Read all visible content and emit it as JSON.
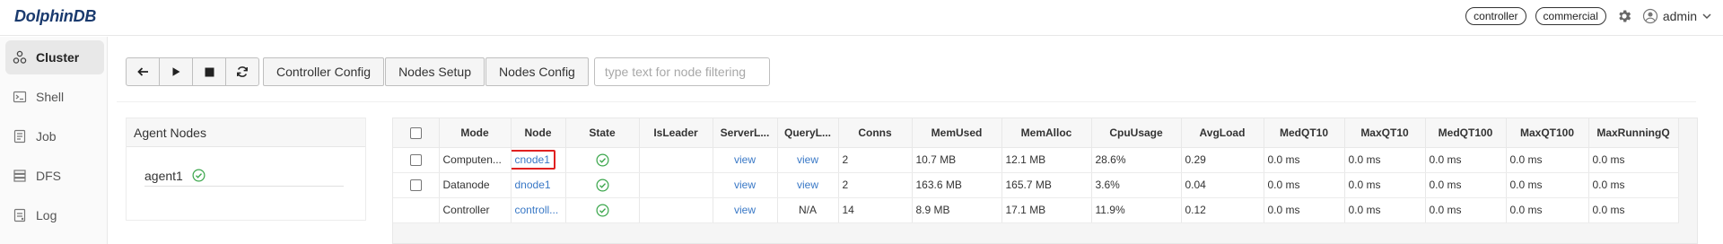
{
  "app": {
    "logo": "DolphinDB"
  },
  "header": {
    "role_badge": "controller",
    "edition_badge": "commercial",
    "settings_icon": "gear-icon",
    "user_icon": "user-circle-icon",
    "username": "admin"
  },
  "sidebar": {
    "items": [
      {
        "label": "Cluster",
        "icon": "cluster-icon",
        "active": true
      },
      {
        "label": "Shell",
        "icon": "shell-icon",
        "active": false
      },
      {
        "label": "Job",
        "icon": "job-icon",
        "active": false
      },
      {
        "label": "DFS",
        "icon": "dfs-icon",
        "active": false
      },
      {
        "label": "Log",
        "icon": "log-icon",
        "active": false
      }
    ]
  },
  "toolbar": {
    "controller_config": "Controller Config",
    "nodes_setup": "Nodes Setup",
    "nodes_config": "Nodes Config",
    "filter_placeholder": "type text for node filtering"
  },
  "agents": {
    "title": "Agent Nodes",
    "items": [
      {
        "name": "agent1",
        "status": "running"
      }
    ]
  },
  "nodes_table": {
    "headers": [
      "Mode",
      "Node",
      "State",
      "IsLeader",
      "ServerL...",
      "QueryL...",
      "Conns",
      "MemUsed",
      "MemAlloc",
      "CpuUsage",
      "AvgLoad",
      "MedQT10",
      "MaxQT10",
      "MedQT100",
      "MaxQT100",
      "MaxRunningQ"
    ],
    "rows": [
      {
        "mode": "Computen...",
        "node": "cnode1",
        "isleader": "",
        "server_log": "view",
        "query_log": "view",
        "conns": "2",
        "mem_used": "10.7 MB",
        "mem_alloc": "12.1 MB",
        "cpu": "28.6%",
        "avg_load": "0.29",
        "med_qt10": "0.0 ms",
        "max_qt10": "0.0 ms",
        "med_qt100": "0.0 ms",
        "max_qt100": "0.0 ms",
        "max_running": "0.0 ms"
      },
      {
        "mode": "Datanode",
        "node": "dnode1",
        "isleader": "",
        "server_log": "view",
        "query_log": "view",
        "conns": "2",
        "mem_used": "163.6 MB",
        "mem_alloc": "165.7 MB",
        "cpu": "3.6%",
        "avg_load": "0.04",
        "med_qt10": "0.0 ms",
        "max_qt10": "0.0 ms",
        "med_qt100": "0.0 ms",
        "max_qt100": "0.0 ms",
        "max_running": "0.0 ms"
      },
      {
        "mode": "Controller",
        "node": "controll...",
        "isleader": "",
        "server_log": "view",
        "query_log": "N/A",
        "conns": "14",
        "mem_used": "8.9 MB",
        "mem_alloc": "17.1 MB",
        "cpu": "11.9%",
        "avg_load": "0.12",
        "med_qt10": "0.0 ms",
        "max_qt10": "0.0 ms",
        "med_qt100": "0.0 ms",
        "max_qt100": "0.0 ms",
        "max_running": "0.0 ms"
      }
    ]
  },
  "colors": {
    "link": "#3978c6",
    "ok": "#3aa64b",
    "highlight": "#e02020"
  }
}
